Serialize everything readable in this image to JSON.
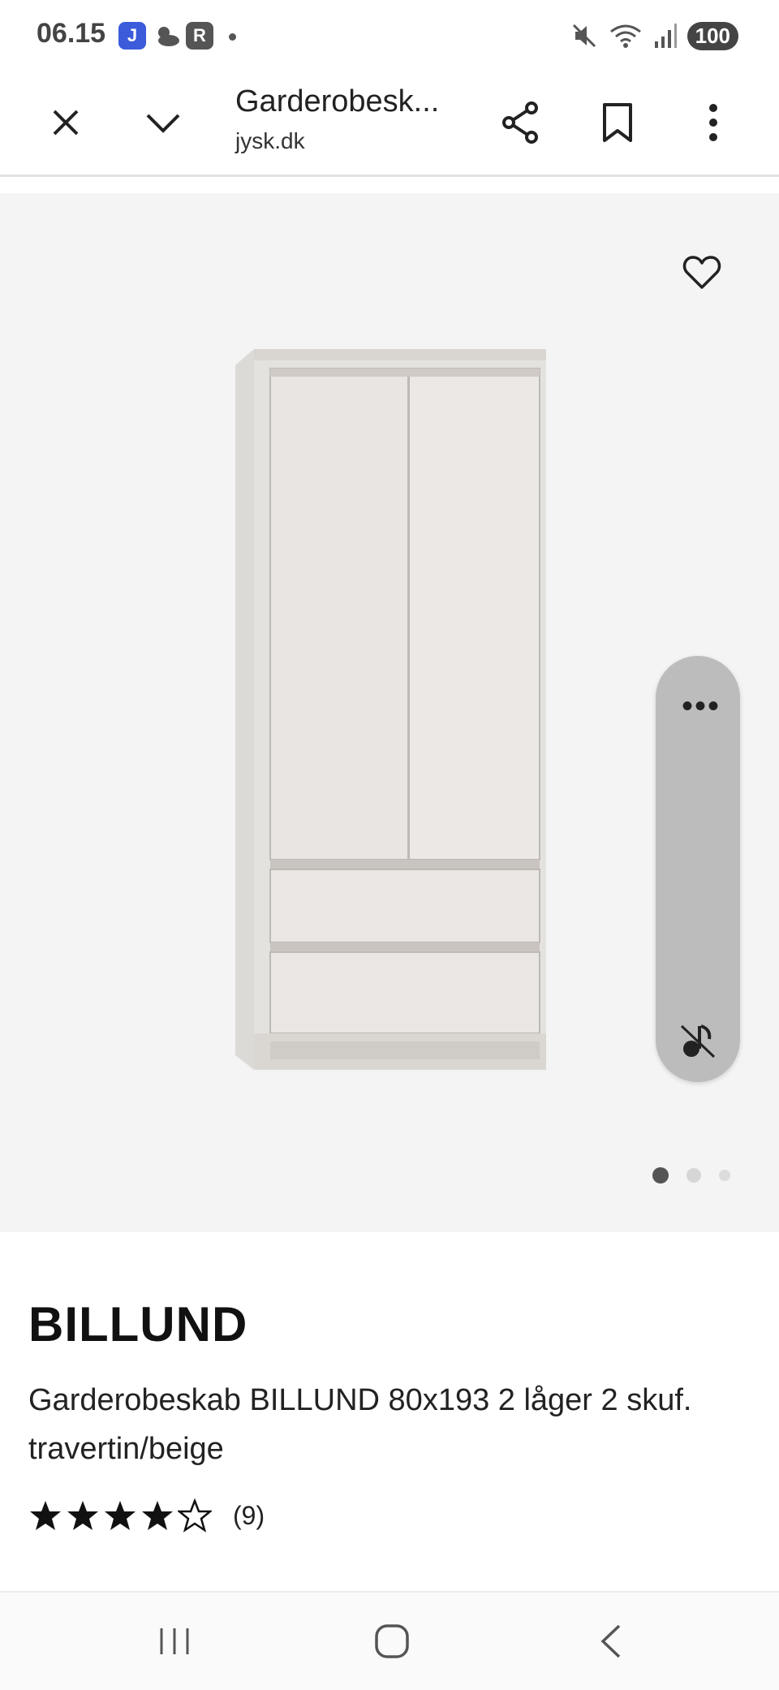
{
  "status_bar": {
    "time": "06.15",
    "app_icons": [
      {
        "name": "translate-app-icon",
        "label": "J",
        "color": "#3b5bdb"
      },
      {
        "name": "weather-icon"
      },
      {
        "name": "r-app-icon",
        "label": "R",
        "color": "#555555"
      }
    ],
    "battery": "100"
  },
  "toolbar": {
    "title": "Garderobesk...",
    "domain": "jysk.dk"
  },
  "gallery": {
    "image": "wardrobe-photo",
    "page_count": 3,
    "current_page": 1
  },
  "product": {
    "brand": "BILLUND",
    "description": "Garderobeskab BILLUND 80x193 2 låger 2 skuf. travertin/beige",
    "rating": 4,
    "rating_max": 5,
    "review_count": "(9)"
  },
  "colors": {
    "hero_bg": "#f4f4f4",
    "bubble": "#bcbcbc",
    "text": "#111111"
  }
}
